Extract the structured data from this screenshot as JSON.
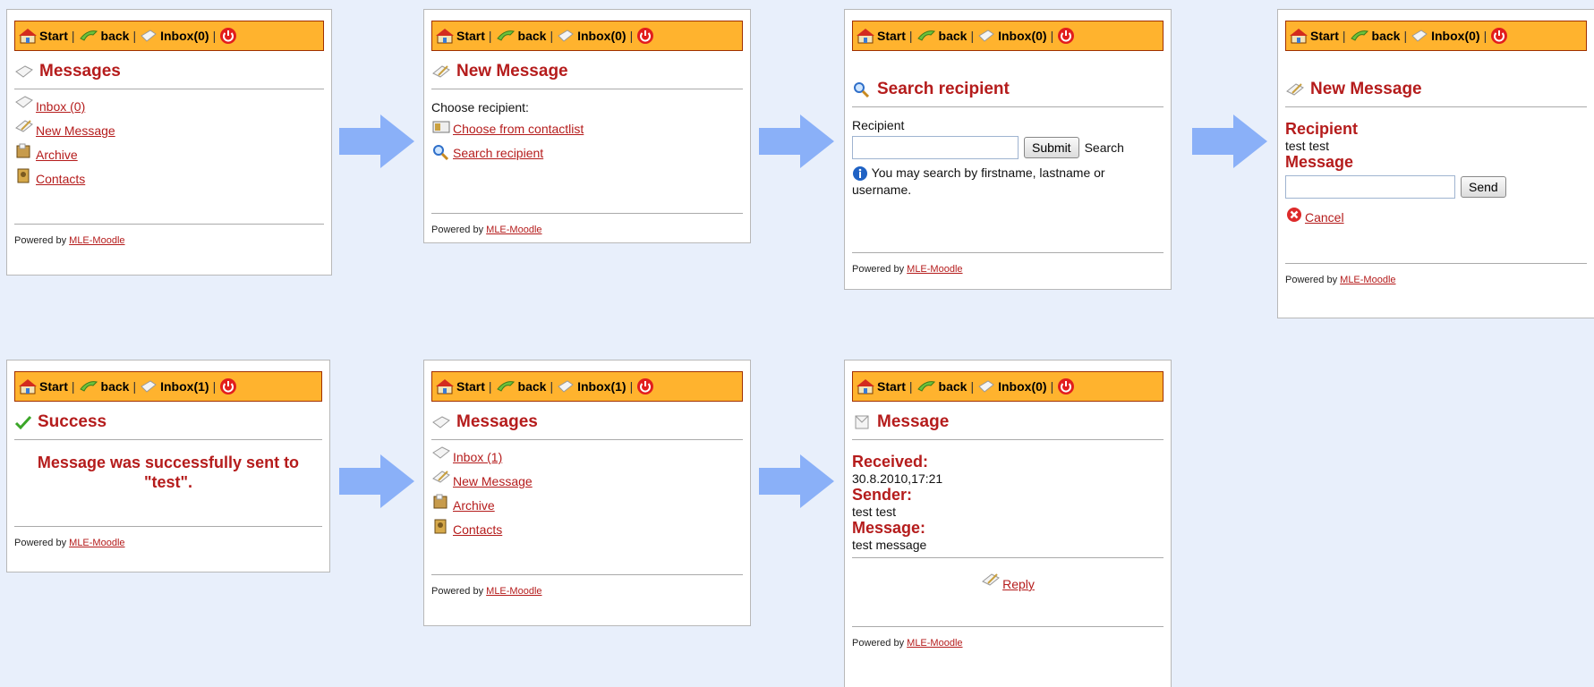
{
  "topbar": {
    "start": "Start",
    "back": "back",
    "inbox0": "Inbox(0)",
    "inbox1": "Inbox(1)",
    "separator": "|"
  },
  "footer": {
    "prefix": "Powered by",
    "link": "MLE-Moodle"
  },
  "screen1": {
    "title": "Messages",
    "links": [
      "Inbox (0)",
      "New Message",
      "Archive",
      "Contacts"
    ]
  },
  "screen2": {
    "title": "New Message",
    "prompt": "Choose recipient:",
    "links": [
      "Choose from contactlist",
      "Search recipient"
    ]
  },
  "screen3": {
    "title": "Search recipient",
    "field_label": "Recipient",
    "submit": "Submit",
    "search": "Search",
    "hint": "You may search by firstname, lastname or username."
  },
  "screen4": {
    "title": "New Message",
    "recipient_label": "Recipient",
    "recipient_value": "test test",
    "message_label": "Message",
    "send": "Send",
    "cancel": "Cancel"
  },
  "screen5": {
    "title": "Success",
    "text": "Message was successfully sent to \"test\"."
  },
  "screen6": {
    "title": "Messages",
    "links": [
      "Inbox (1)",
      "New Message",
      "Archive",
      "Contacts"
    ]
  },
  "screen7": {
    "title": "Message",
    "received_label": "Received:",
    "received_value": "30.8.2010,17:21",
    "sender_label": "Sender:",
    "sender_value": "test test",
    "message_label": "Message:",
    "message_value": "test message",
    "reply": "Reply"
  },
  "colors": {
    "accent_red": "#b51c1c",
    "topbar_orange": "#ffb32e",
    "arrow_blue": "#8ab0f8",
    "background": "#e8effb"
  },
  "icons": [
    "home-icon",
    "back-arrow-icon",
    "envelope-icon",
    "power-icon",
    "pencil-icon",
    "contact-card-icon",
    "magnifier-icon",
    "archive-icon",
    "contacts-book-icon",
    "info-icon",
    "cancel-icon",
    "checkmark-icon",
    "flow-arrow-icon"
  ]
}
